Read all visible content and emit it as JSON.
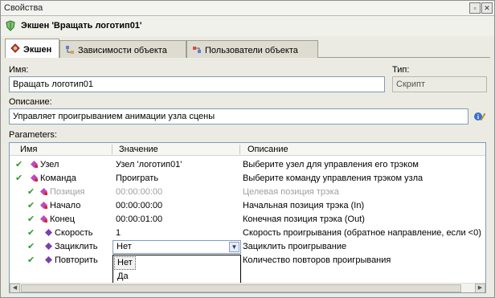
{
  "window": {
    "title": "Свойства"
  },
  "header": {
    "title": "Экшен 'Вращать логотип01'"
  },
  "tabs": [
    {
      "label": "Экшен"
    },
    {
      "label": "Зависимости объекта"
    },
    {
      "label": "Пользователи объекта"
    }
  ],
  "form": {
    "name_label": "Имя:",
    "name_value": "Вращать логотип01",
    "type_label": "Тип:",
    "type_value": "Скрипт",
    "desc_label": "Описание:",
    "desc_value": "Управляет проигрыванием анимации узла сцены",
    "params_label": "Parameters:"
  },
  "grid": {
    "columns": [
      "Имя",
      "Значение",
      "Описание"
    ],
    "rows": [
      {
        "name": "Узел",
        "value": "Узел 'логотип01'",
        "desc": "Выберите узел для управления его трэком"
      },
      {
        "name": "Команда",
        "value": "Проиграть",
        "desc": "Выберите команду управления трэком узла"
      },
      {
        "name": "Позиция",
        "value": "00:00:00:00",
        "desc": "Целевая позиция трэка"
      },
      {
        "name": "Начало",
        "value": "00:00:00:00",
        "desc": "Начальная позиция трэка (In)"
      },
      {
        "name": "Конец",
        "value": "00:00:01:00",
        "desc": "Конечная позиция трэка (Out)"
      },
      {
        "name": "Скорость",
        "value": "1",
        "desc": "Скорость проигрывания (обратное направление, если <0)"
      },
      {
        "name": "Зациклить",
        "value": "Нет",
        "desc": "Зациклить проигрывание"
      },
      {
        "name": "Повторить",
        "value": "",
        "desc": "Количество повторов проигрывания"
      }
    ],
    "dropdown_options": [
      "Нет",
      "Да"
    ]
  },
  "colors": {
    "check": "#2e9a2e",
    "bullet_pink": "#c048c0",
    "bullet_purple": "#7a3fb0",
    "bullet_red": "#d02828"
  },
  "icons": {
    "header": "shield-icon",
    "info": "info-pencil-icon"
  }
}
